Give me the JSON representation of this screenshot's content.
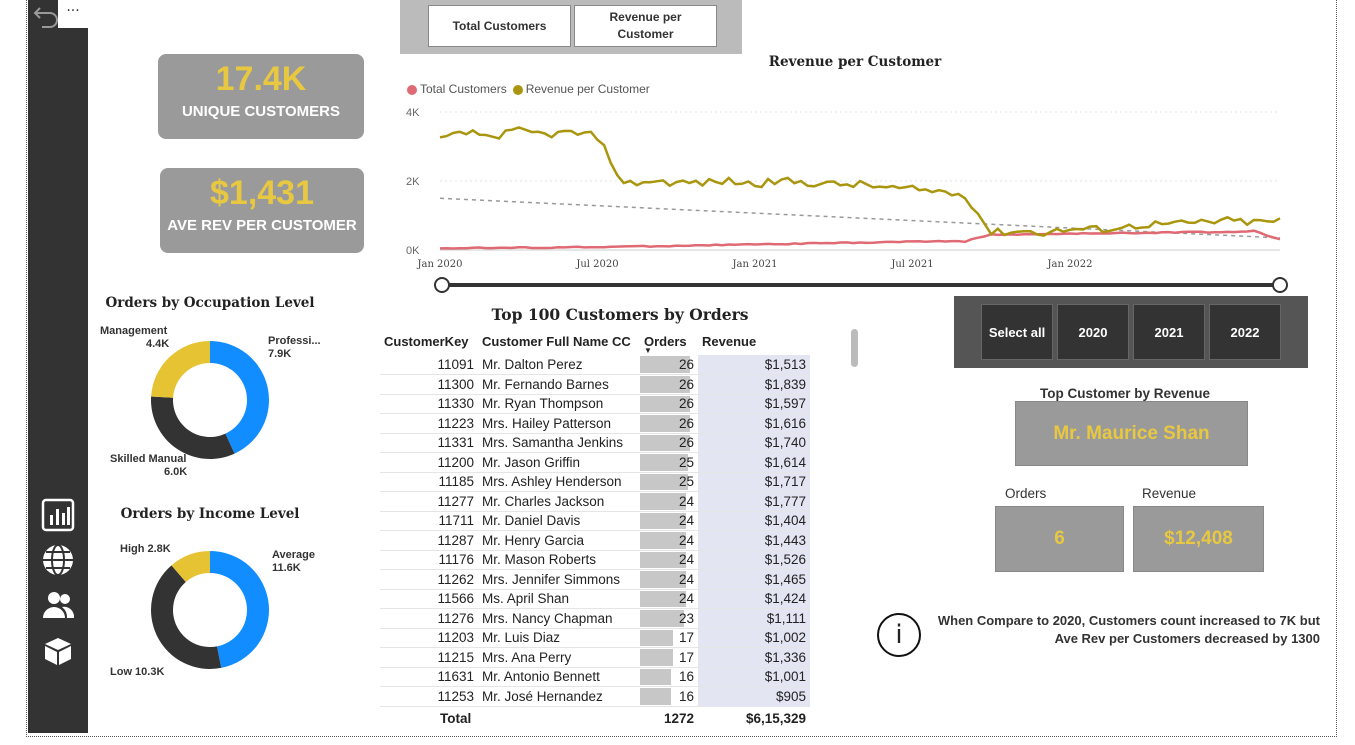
{
  "sidebar": {
    "back_icon": "back-arrow-icon",
    "more": "···",
    "icons": [
      "bar-chart-icon",
      "globe-icon",
      "users-icon",
      "box-icon"
    ]
  },
  "kpis": {
    "unique_customers": {
      "value": "17.4K",
      "label": "UNIQUE CUSTOMERS"
    },
    "ave_rev": {
      "value": "$1,431",
      "label": "AVE REV PER CUSTOMER"
    }
  },
  "toggle": {
    "total_customers": "Total Customers",
    "revenue_per_customer_l1": "Revenue per",
    "revenue_per_customer_l2": "Customer"
  },
  "line_chart": {
    "title": "Revenue per Customer",
    "legend": [
      {
        "name": "Total Customers",
        "color": "#e06a74"
      },
      {
        "name": "Revenue per Customer",
        "color": "#a9960e"
      }
    ],
    "y_ticks": [
      "4K",
      "2K",
      "0K"
    ],
    "x_ticks": [
      "Jan 2020",
      "Jul 2020",
      "Jan 2021",
      "Jul 2021",
      "Jan 2022"
    ]
  },
  "chart_data": [
    {
      "type": "line",
      "title": "Revenue per Customer",
      "x_range": [
        "Jan 2020",
        "Jun 2022"
      ],
      "ylim": [
        0,
        4000
      ],
      "series": [
        {
          "name": "Revenue per Customer",
          "approx_values": [
            3200,
            3400,
            3300,
            3450,
            3350,
            3400,
            3300,
            1900,
            2000,
            1950,
            1950,
            2000,
            1900,
            2000,
            1950,
            1900,
            1900,
            1800,
            1750,
            1700,
            1600,
            500,
            550,
            500,
            600,
            600,
            650,
            750,
            750,
            800,
            850,
            800,
            850
          ]
        },
        {
          "name": "Total Customers",
          "approx_values": [
            50,
            60,
            60,
            70,
            70,
            80,
            80,
            100,
            110,
            120,
            140,
            150,
            160,
            170,
            190,
            200,
            210,
            230,
            240,
            260,
            250,
            450,
            450,
            460,
            470,
            480,
            490,
            500,
            510,
            520,
            520,
            550,
            300
          ]
        }
      ],
      "trendline": {
        "from": 1500,
        "to": 350
      }
    },
    {
      "type": "pie",
      "title": "Orders by Occupation Level",
      "labels": [
        "Professi...",
        "Skilled Manual",
        "Management"
      ],
      "values": [
        7900,
        6000,
        4400
      ],
      "colors": [
        "#118dff",
        "#333333",
        "#e5c333"
      ]
    },
    {
      "type": "pie",
      "title": "Orders by Income Level",
      "labels": [
        "Average",
        "Low",
        "High"
      ],
      "values": [
        11600,
        10300,
        2800
      ],
      "colors": [
        "#118dff",
        "#333333",
        "#e5c333"
      ]
    }
  ],
  "occupation": {
    "title": "Orders by Occupation Level",
    "labels": {
      "management": "Management",
      "management_val": "4.4K",
      "prof": "Professi...",
      "prof_val": "7.9K",
      "skilled": "Skilled Manual",
      "skilled_val": "6.0K"
    }
  },
  "income": {
    "title": "Orders by Income Level",
    "labels": {
      "high": "High 2.8K",
      "average": "Average",
      "average_val": "11.6K",
      "low": "Low 10.3K"
    }
  },
  "table": {
    "title": "Top 100 Customers by Orders",
    "headers": [
      "CustomerKey",
      "Customer Full Name CC",
      "Orders",
      "Revenue"
    ],
    "sort_icon": "sort-desc-icon",
    "rows": [
      [
        "11091",
        "Mr. Dalton Perez",
        "26",
        "$1,513"
      ],
      [
        "11300",
        "Mr. Fernando Barnes",
        "26",
        "$1,839"
      ],
      [
        "11330",
        "Mr. Ryan Thompson",
        "26",
        "$1,597"
      ],
      [
        "11223",
        "Mrs. Hailey Patterson",
        "26",
        "$1,616"
      ],
      [
        "11331",
        "Mrs. Samantha Jenkins",
        "26",
        "$1,740"
      ],
      [
        "11200",
        "Mr. Jason Griffin",
        "25",
        "$1,614"
      ],
      [
        "11185",
        "Mrs. Ashley Henderson",
        "25",
        "$1,717"
      ],
      [
        "11277",
        "Mr. Charles Jackson",
        "24",
        "$1,777"
      ],
      [
        "11711",
        "Mr. Daniel Davis",
        "24",
        "$1,404"
      ],
      [
        "11287",
        "Mr. Henry Garcia",
        "24",
        "$1,443"
      ],
      [
        "11176",
        "Mr. Mason Roberts",
        "24",
        "$1,526"
      ],
      [
        "11262",
        "Mrs. Jennifer Simmons",
        "24",
        "$1,465"
      ],
      [
        "11566",
        "Ms. April Shan",
        "24",
        "$1,424"
      ],
      [
        "11276",
        "Mrs. Nancy Chapman",
        "23",
        "$1,111"
      ],
      [
        "11203",
        "Mr. Luis Diaz",
        "17",
        "$1,002"
      ],
      [
        "11215",
        "Mrs. Ana Perry",
        "17",
        "$1,336"
      ],
      [
        "11631",
        "Mr. Antonio Bennett",
        "16",
        "$1,001"
      ],
      [
        "11253",
        "Mr. José Hernandez",
        "16",
        "$905"
      ]
    ],
    "total": {
      "label": "Total",
      "orders": "1272",
      "revenue": "$6,15,329"
    }
  },
  "years": {
    "select_all": "Select all",
    "y2020": "2020",
    "y2021": "2021",
    "y2022": "2022"
  },
  "top_customer": {
    "title": "Top Customer by Revenue",
    "name": "Mr. Maurice Shan",
    "orders_label": "Orders",
    "revenue_label": "Revenue",
    "orders": "6",
    "revenue": "$12,408"
  },
  "info": {
    "icon": "info-icon",
    "symbol": "i",
    "line1": "When Compare to 2020, Customers count increased to 7K but",
    "line2": "Ave Rev per Customers decreased by 1300"
  }
}
